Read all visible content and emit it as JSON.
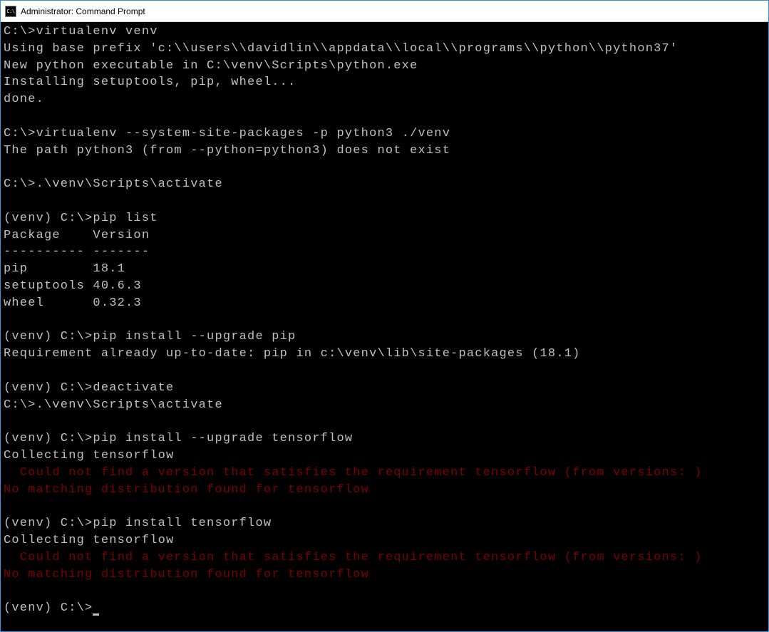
{
  "window": {
    "title": "Administrator: Command Prompt",
    "icon_label": "C:\\"
  },
  "terminal": {
    "lines": [
      {
        "text": "C:\\>virtualenv venv",
        "cls": ""
      },
      {
        "text": "Using base prefix 'c:\\\\users\\\\davidlin\\\\appdata\\\\local\\\\programs\\\\python\\\\python37'",
        "cls": ""
      },
      {
        "text": "New python executable in C:\\venv\\Scripts\\python.exe",
        "cls": ""
      },
      {
        "text": "Installing setuptools, pip, wheel...",
        "cls": ""
      },
      {
        "text": "done.",
        "cls": ""
      },
      {
        "text": "",
        "cls": ""
      },
      {
        "text": "C:\\>virtualenv --system-site-packages -p python3 ./venv",
        "cls": ""
      },
      {
        "text": "The path python3 (from --python=python3) does not exist",
        "cls": ""
      },
      {
        "text": "",
        "cls": ""
      },
      {
        "text": "C:\\>.\\venv\\Scripts\\activate",
        "cls": ""
      },
      {
        "text": "",
        "cls": ""
      },
      {
        "text": "(venv) C:\\>pip list",
        "cls": ""
      },
      {
        "text": "Package    Version",
        "cls": ""
      },
      {
        "text": "---------- -------",
        "cls": ""
      },
      {
        "text": "pip        18.1",
        "cls": ""
      },
      {
        "text": "setuptools 40.6.3",
        "cls": ""
      },
      {
        "text": "wheel      0.32.3",
        "cls": ""
      },
      {
        "text": "",
        "cls": ""
      },
      {
        "text": "(venv) C:\\>pip install --upgrade pip",
        "cls": ""
      },
      {
        "text": "Requirement already up-to-date: pip in c:\\venv\\lib\\site-packages (18.1)",
        "cls": ""
      },
      {
        "text": "",
        "cls": ""
      },
      {
        "text": "(venv) C:\\>deactivate",
        "cls": ""
      },
      {
        "text": "C:\\>.\\venv\\Scripts\\activate",
        "cls": ""
      },
      {
        "text": "",
        "cls": ""
      },
      {
        "text": "(venv) C:\\>pip install --upgrade tensorflow",
        "cls": ""
      },
      {
        "text": "Collecting tensorflow",
        "cls": ""
      },
      {
        "text": "  Could not find a version that satisfies the requirement tensorflow (from versions: )",
        "cls": "err"
      },
      {
        "text": "No matching distribution found for tensorflow",
        "cls": "err"
      },
      {
        "text": "",
        "cls": ""
      },
      {
        "text": "(venv) C:\\>pip install tensorflow",
        "cls": ""
      },
      {
        "text": "Collecting tensorflow",
        "cls": ""
      },
      {
        "text": "  Could not find a version that satisfies the requirement tensorflow (from versions: )",
        "cls": "err"
      },
      {
        "text": "No matching distribution found for tensorflow",
        "cls": "err"
      },
      {
        "text": "",
        "cls": ""
      }
    ],
    "prompt": "(venv) C:\\>"
  }
}
